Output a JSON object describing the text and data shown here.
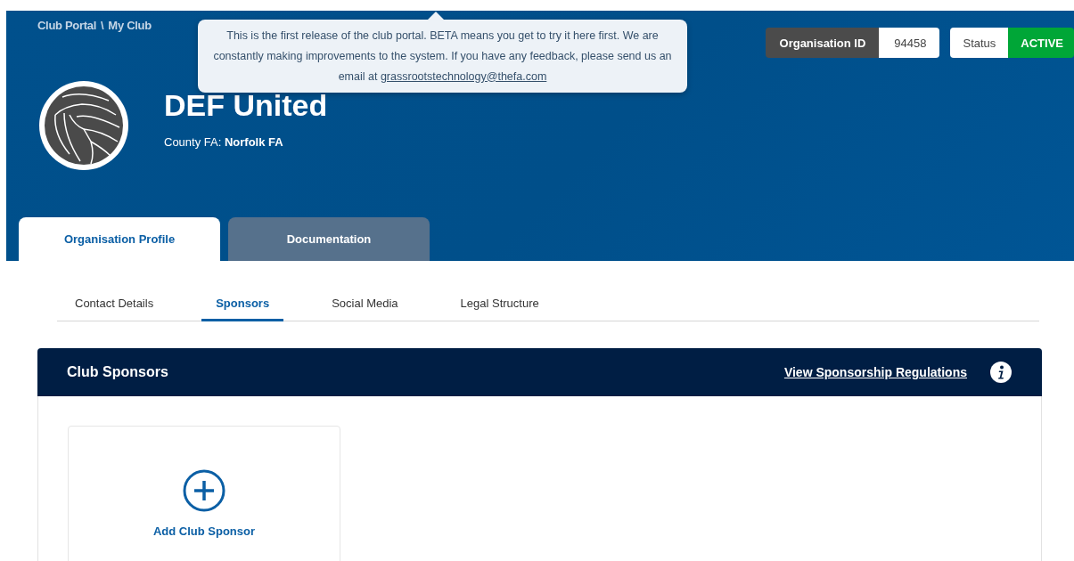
{
  "breadcrumb": [
    "Club Portal",
    "My Club"
  ],
  "breadcrumb_separator": "\\",
  "notice": {
    "text": "This is the first release of the club portal. BETA means you get to try it here first. We are constantly making improvements to the system. If you have any feedback, please send us an email at",
    "link": "grassrootstechnology@thefa.com"
  },
  "organisation_id": {
    "label": "Organisation ID",
    "value": "94458"
  },
  "status": {
    "label": "Status",
    "value": "ACTIVE"
  },
  "club": {
    "name": "DEF United",
    "county_label": "County FA:",
    "county": "Norfolk FA"
  },
  "tabs": [
    {
      "label": "Organisation Profile",
      "selected": true
    },
    {
      "label": "Documentation",
      "selected": false
    }
  ],
  "subtabs": [
    {
      "label": "Contact Details",
      "selected": false
    },
    {
      "label": "Sponsors",
      "selected": true
    },
    {
      "label": "Social Media",
      "selected": false
    },
    {
      "label": "Legal Structure",
      "selected": false
    }
  ],
  "panel": {
    "title": "Club Sponsors",
    "link": "View Sponsorship Regulations",
    "add_label": "Add Club Sponsor"
  }
}
